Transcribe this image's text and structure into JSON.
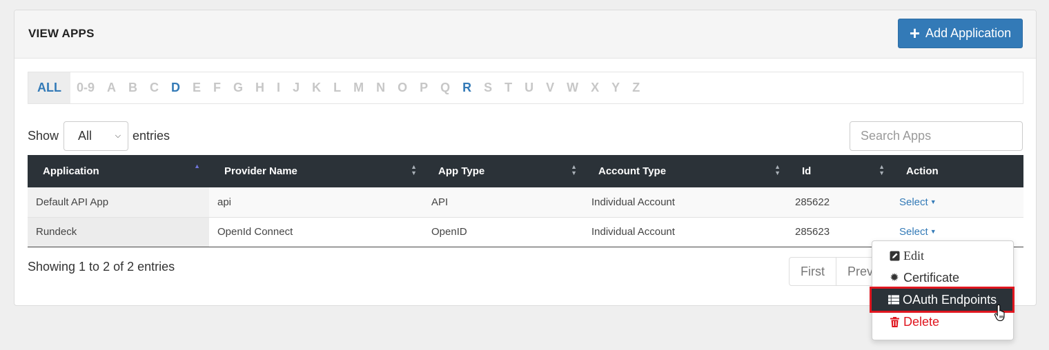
{
  "header": {
    "title": "VIEW APPS",
    "add_button": "Add Application"
  },
  "alphabet": [
    "ALL",
    "0-9",
    "A",
    "B",
    "C",
    "D",
    "E",
    "F",
    "G",
    "H",
    "I",
    "J",
    "K",
    "L",
    "M",
    "N",
    "O",
    "P",
    "Q",
    "R",
    "S",
    "T",
    "U",
    "V",
    "W",
    "X",
    "Y",
    "Z"
  ],
  "alphabet_active": [
    "ALL",
    "D",
    "R"
  ],
  "length": {
    "show_label": "Show",
    "selected": "All",
    "entries_label": "entries"
  },
  "search": {
    "placeholder": "Search Apps"
  },
  "table": {
    "columns": [
      "Application",
      "Provider Name",
      "App Type",
      "Account Type",
      "Id",
      "Action"
    ],
    "rows": [
      {
        "application": "Default API App",
        "provider": "api",
        "app_type": "API",
        "account_type": "Individual Account",
        "id": "285622",
        "action": "Select"
      },
      {
        "application": "Rundeck",
        "provider": "OpenId Connect",
        "app_type": "OpenID",
        "account_type": "Individual Account",
        "id": "285623",
        "action": "Select"
      }
    ]
  },
  "info": "Showing 1 to 2 of 2 entries",
  "pagination": {
    "first": "First",
    "previous": "Previ"
  },
  "dropdown": {
    "items": [
      {
        "label": "Edit",
        "icon": "edit-icon"
      },
      {
        "label": "Certificate",
        "icon": "certificate-icon"
      },
      {
        "label": "OAuth Endpoints",
        "icon": "list-icon",
        "selected": true
      },
      {
        "label": "Delete",
        "icon": "trash-icon",
        "color": "#e0161f"
      }
    ]
  },
  "colors": {
    "accent": "#337ab7",
    "table_header": "#2b3238",
    "danger": "#e0161f",
    "highlight_border": "#e0161f"
  }
}
